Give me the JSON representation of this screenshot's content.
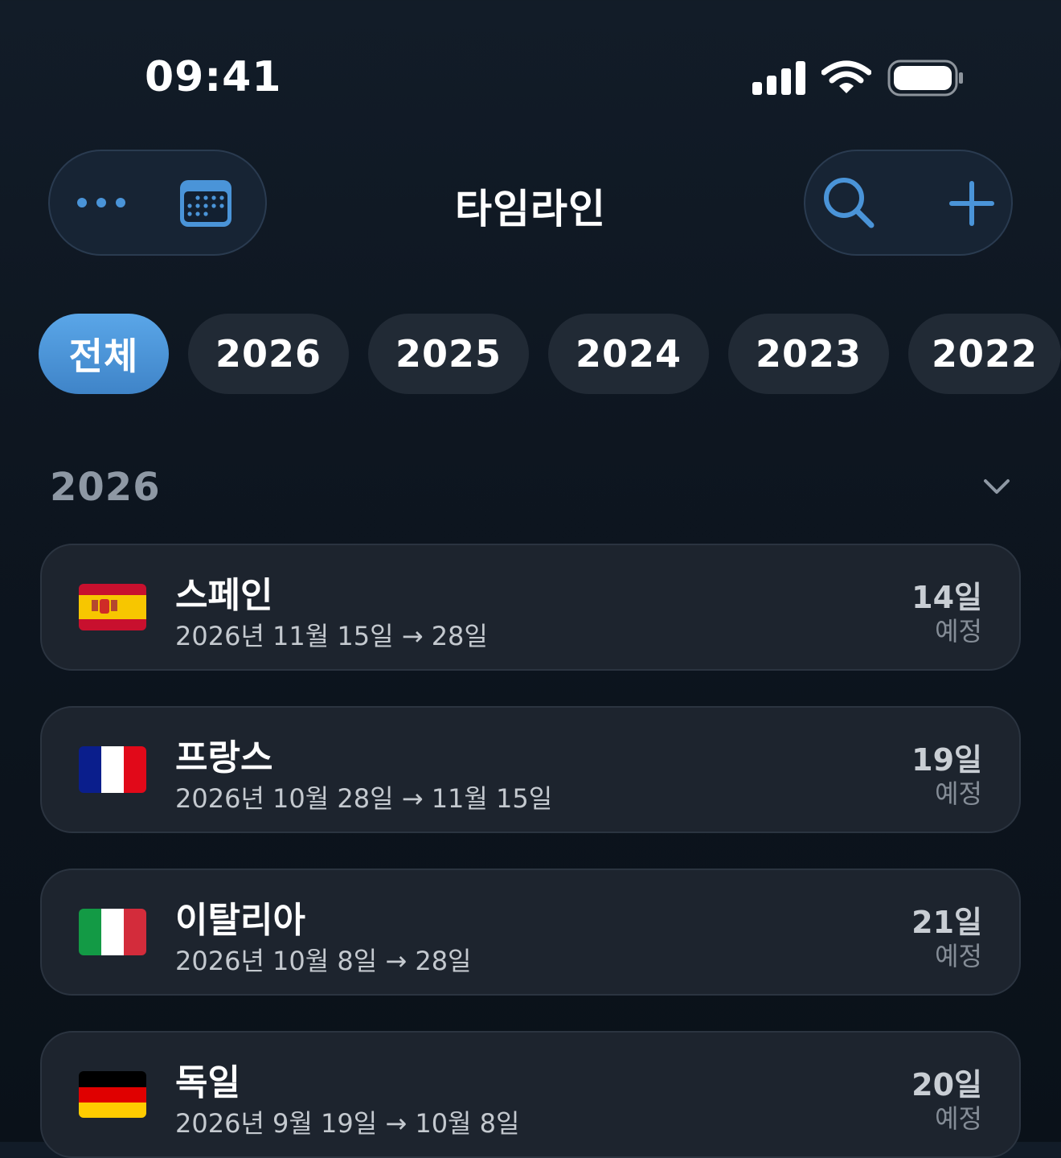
{
  "status_bar": {
    "time": "09:41"
  },
  "header": {
    "title": "타임라인",
    "more_icon": "ellipsis-icon",
    "calendar_icon": "calendar-icon",
    "search_icon": "search-icon",
    "add_icon": "plus-icon"
  },
  "filters": [
    {
      "label": "전체",
      "active": true
    },
    {
      "label": "2026",
      "active": false
    },
    {
      "label": "2025",
      "active": false
    },
    {
      "label": "2024",
      "active": false
    },
    {
      "label": "2023",
      "active": false
    },
    {
      "label": "2022",
      "active": false
    }
  ],
  "section": {
    "title": "2026",
    "chevron_icon": "chevron-down-icon"
  },
  "trips": [
    {
      "country": "스페인",
      "flag": "spain-flag",
      "dates": "2026년 11월 15일 → 28일",
      "days": "14일",
      "status": "예정"
    },
    {
      "country": "프랑스",
      "flag": "france-flag",
      "dates": "2026년 10월 28일 → 11월 15일",
      "days": "19일",
      "status": "예정"
    },
    {
      "country": "이탈리아",
      "flag": "italy-flag",
      "dates": "2026년 10월 8일 → 28일",
      "days": "21일",
      "status": "예정"
    },
    {
      "country": "독일",
      "flag": "germany-flag",
      "dates": "2026년 9월 19일 → 10월 8일",
      "days": "20일",
      "status": "예정"
    }
  ],
  "colors": {
    "accent": "#4a94d8",
    "background": "#0d151f",
    "card": "#1d242e"
  }
}
